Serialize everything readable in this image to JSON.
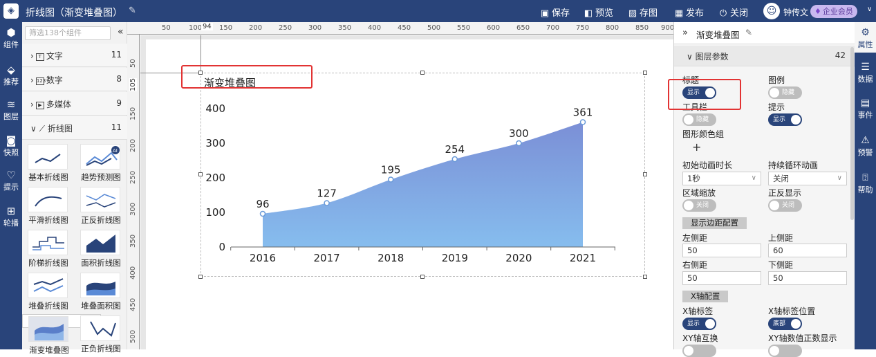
{
  "topbar": {
    "title": "折线图（渐变堆叠图）",
    "actions": [
      {
        "label": "保存",
        "icon": "save-icon"
      },
      {
        "label": "预览",
        "icon": "preview-icon"
      },
      {
        "label": "存图",
        "icon": "image-icon"
      },
      {
        "label": "发布",
        "icon": "publish-icon"
      },
      {
        "label": "关闭",
        "icon": "power-icon"
      }
    ],
    "user": "钟传文",
    "badge": "企业会员"
  },
  "leftnav": [
    {
      "label": "组件",
      "icon": "component-icon"
    },
    {
      "label": "推荐",
      "icon": "recommend-icon"
    },
    {
      "label": "图层",
      "icon": "layers-icon"
    },
    {
      "label": "快照",
      "icon": "camera-icon"
    },
    {
      "label": "提示",
      "icon": "tip-icon"
    },
    {
      "label": "轮播",
      "icon": "carousel-icon"
    }
  ],
  "panel": {
    "filter_placeholder": "筛选138个组件",
    "categories": [
      {
        "label": "文字",
        "count": "11",
        "icon_text": "T"
      },
      {
        "label": "数字",
        "count": "8",
        "icon_text": "123"
      },
      {
        "label": "多媒体",
        "count": "9",
        "icon_text": "▶"
      },
      {
        "label": "折线图",
        "count": "11",
        "icon_text": ""
      }
    ],
    "components": [
      "基本折线图",
      "趋势预测图",
      "平滑折线图",
      "正反折线图",
      "阶梯折线图",
      "面积折线图",
      "堆叠折线图",
      "堆叠面积图",
      "渐变堆叠图",
      "正负折线图"
    ]
  },
  "ruler": {
    "ticks": [
      "50",
      "100",
      "150",
      "200",
      "250",
      "300",
      "350",
      "400",
      "450",
      "500",
      "550",
      "600",
      "650",
      "700",
      "750",
      "800",
      "850",
      "900"
    ],
    "vticks": [
      "50",
      "100",
      "150",
      "200",
      "250",
      "300",
      "350",
      "400",
      "450",
      "500"
    ],
    "marker": "94",
    "vmarker": "105"
  },
  "chart_data": {
    "type": "area",
    "title": "渐变堆叠图",
    "categories": [
      "2016",
      "2017",
      "2018",
      "2019",
      "2020",
      "2021"
    ],
    "series": [
      {
        "values": [
          96,
          127,
          195,
          254,
          300,
          361
        ]
      }
    ],
    "yticks": [
      "0",
      "100",
      "200",
      "300",
      "400"
    ],
    "ylim": [
      0,
      400
    ],
    "smooth": true,
    "gradient": [
      "#7b8fd6",
      "#86bdee"
    ],
    "legend": false,
    "grid": false
  },
  "rightpanel": {
    "component_name": "渐变堆叠图",
    "section": {
      "label": "图层参数",
      "count": "42"
    },
    "fields": {
      "title": {
        "label": "标题",
        "toggle": "显示",
        "on": true
      },
      "legend": {
        "label": "图例",
        "toggle": "隐藏",
        "on": false
      },
      "toolbar": {
        "label": "工具栏",
        "toggle": "隐藏",
        "on": false
      },
      "tooltip": {
        "label": "提示",
        "toggle": "显示",
        "on": true
      },
      "colors": {
        "label": "图形颜色组",
        "add": "+"
      },
      "init_anim": {
        "label": "初始动画时长",
        "value": "1秒"
      },
      "loop_anim": {
        "label": "持续循环动画",
        "value": "关闭"
      },
      "zoom": {
        "label": "区域缩放",
        "toggle": "关闭",
        "on": false
      },
      "reverse": {
        "label": "正反显示",
        "toggle": "关闭",
        "on": false
      },
      "margin_btn": "显示边距配置",
      "left": {
        "label": "左侧距",
        "value": "50"
      },
      "top": {
        "label": "上侧距",
        "value": "60"
      },
      "right": {
        "label": "右侧距",
        "value": "50"
      },
      "bottom": {
        "label": "下侧距",
        "value": "50"
      },
      "xaxis_btn": "X轴配置",
      "xlabel": {
        "label": "X轴标签",
        "toggle": "显示",
        "on": true
      },
      "xlabel_pos": {
        "label": "X轴标签位置",
        "toggle": "底部",
        "on": true
      },
      "xy_swap": {
        "label": "XY轴互换"
      },
      "xy_int": {
        "label": "XY轴数值正数显示"
      }
    }
  },
  "rightnav": [
    {
      "label": "属性",
      "icon": "property-icon"
    },
    {
      "label": "数据",
      "icon": "database-icon"
    },
    {
      "label": "事件",
      "icon": "event-icon"
    },
    {
      "label": "预警",
      "icon": "alarm-icon"
    },
    {
      "label": "帮助",
      "icon": "help-icon"
    }
  ]
}
